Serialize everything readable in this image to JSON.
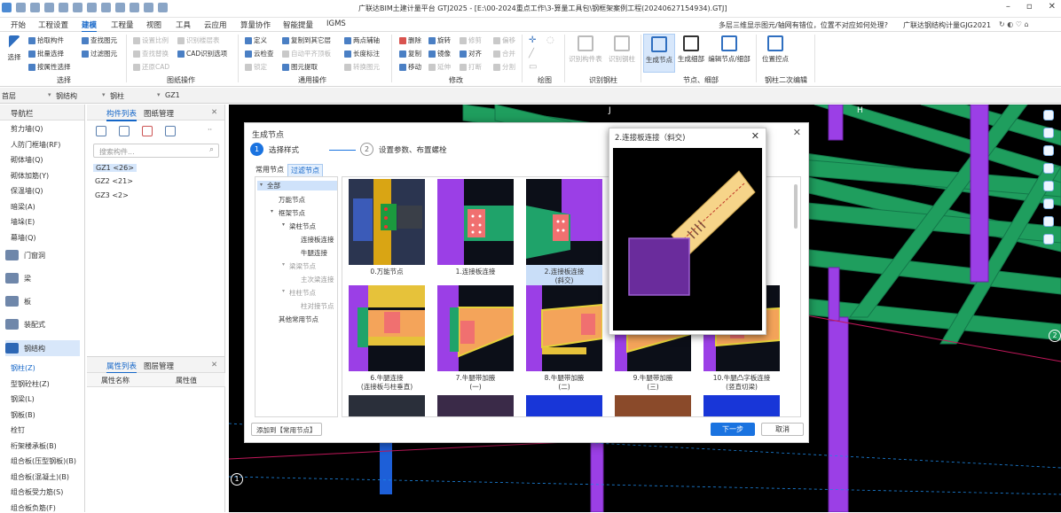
{
  "app": {
    "title": "广联达BIM土建计量平台 GTJ2025 - [E:\\00-2024重点工作\\3-算量工具包\\钢框架案例工程(20240627154934).GTJ]"
  },
  "menu": {
    "items": [
      "开始",
      "工程设置",
      "建模",
      "工程量",
      "视图",
      "工具",
      "云应用",
      "算量协作",
      "智能提量",
      "IGMS"
    ],
    "active": "建模",
    "help_question": "多层三维显示图元/轴网有错位，位置不对应如何处理?",
    "product": "广联达钢结构计量GJG2021"
  },
  "ribbon": {
    "select": "选择",
    "pick": "拾取构件",
    "batch": "批量选择",
    "by_attr": "按属性选择",
    "find": "查找图元",
    "filter": "过滤图元",
    "set_scale": "设置比例",
    "find_replace": "查找替换",
    "restore_cad": "还原CAD",
    "recog_layer": "识别楼层表",
    "cad_options": "CAD识别选项",
    "define": "定义",
    "cloud_check": "云检查",
    "lock": "锁定",
    "copy_floor": "复制到其它层",
    "auto_level": "自动平齐顶板",
    "extract": "图元提取",
    "two_point_axis": "两点辅轴",
    "length_mark": "长度标注",
    "convert": "转换图元",
    "delete": "删除",
    "copy": "复制",
    "move": "移动",
    "rotate": "旋转",
    "mirror": "镜像",
    "align": "对齐",
    "trim": "修剪",
    "extend": "延伸",
    "break": "打断",
    "offset": "偏移",
    "merge": "合并",
    "split": "分割",
    "recog_member": "识别构件表",
    "recog_steel": "识别钢柱",
    "gen_node": "生成节点",
    "gen_detail": "生成细部",
    "edit_node": "编辑节点/细部",
    "position_ctrl": "位置控点",
    "groups": {
      "select": "选择",
      "drawing_ops": "图纸操作",
      "general_ops": "通用操作",
      "modify": "修改",
      "draw": "绘图",
      "recog_steel": "识别钢柱",
      "node_detail": "节点、细部",
      "steel_2nd": "钢柱二次编辑"
    }
  },
  "selectors": {
    "floor": "首层",
    "category": "钢结构",
    "type": "钢柱",
    "member": "GZ1"
  },
  "nav": {
    "title": "导航栏",
    "items_top": [
      "剪力墙(Q)",
      "人防门框墙(RF)",
      "砌体墙(Q)",
      "砌体加筋(Y)",
      "保温墙(Q)",
      "暗梁(A)",
      "墙垛(E)",
      "幕墙(Q)"
    ],
    "groups": [
      "门窗洞",
      "梁",
      "板",
      "装配式",
      "钢结构"
    ],
    "items_bottom": [
      "钢柱(Z)",
      "型钢砼柱(Z)",
      "钢梁(L)",
      "钢板(B)",
      "栓钉",
      "桁架楼承板(B)",
      "组合板(压型钢板)(B)",
      "组合板(混凝土)(B)",
      "组合板受力筋(S)",
      "组合板负筋(F)"
    ]
  },
  "components": {
    "tab_list": "构件列表",
    "tab_drawings": "图纸管理",
    "search_placeholder": "搜索构件...",
    "items": [
      "GZ1 <26>",
      "GZ2 <21>",
      "GZ3 <2>"
    ]
  },
  "props": {
    "tab_props": "属性列表",
    "tab_layers": "图层管理",
    "col_name": "属性名称",
    "col_value": "属性值"
  },
  "canvas": {
    "axis_labels": [
      "J",
      "H",
      "1",
      "2"
    ]
  },
  "dialog": {
    "title": "生成节点",
    "step1": "选择样式",
    "step2": "设置参数、布置螺栓",
    "step1_num": "1",
    "step2_num": "2",
    "tab_common": "常用节点",
    "tab_filter": "过滤节点",
    "tree": {
      "all": "全部",
      "universal": "万能节点",
      "frame": "框架节点",
      "beam_col": "梁柱节点",
      "plate_conn": "连接板连接",
      "bracket": "牛腿连接",
      "beam_beam": "梁梁节点",
      "secondary": "主次梁连接",
      "col_col": "柱柱节点",
      "col_splice": "柱对接节点",
      "other": "其他常用节点"
    },
    "nodes": [
      {
        "label": "0.万能节点"
      },
      {
        "label": "1.连接板连接"
      },
      {
        "label": "2.连接板连接\n(斜交)"
      },
      {
        "label": "6.牛腿连接\n(连接板与柱垂直)"
      },
      {
        "label": "7.牛腿带加腋\n(一)"
      },
      {
        "label": "8.牛腿带加腋\n(二)"
      },
      {
        "label": "9.牛腿带加腋\n(三)"
      },
      {
        "label": "10.牛腿凸字板连接\n(竖直切梁)"
      }
    ],
    "add_btn": "添加到【常用节点】",
    "next_btn": "下一步",
    "cancel_btn": "取消"
  },
  "preview": {
    "title": "2.连接板连接（斜交)"
  }
}
